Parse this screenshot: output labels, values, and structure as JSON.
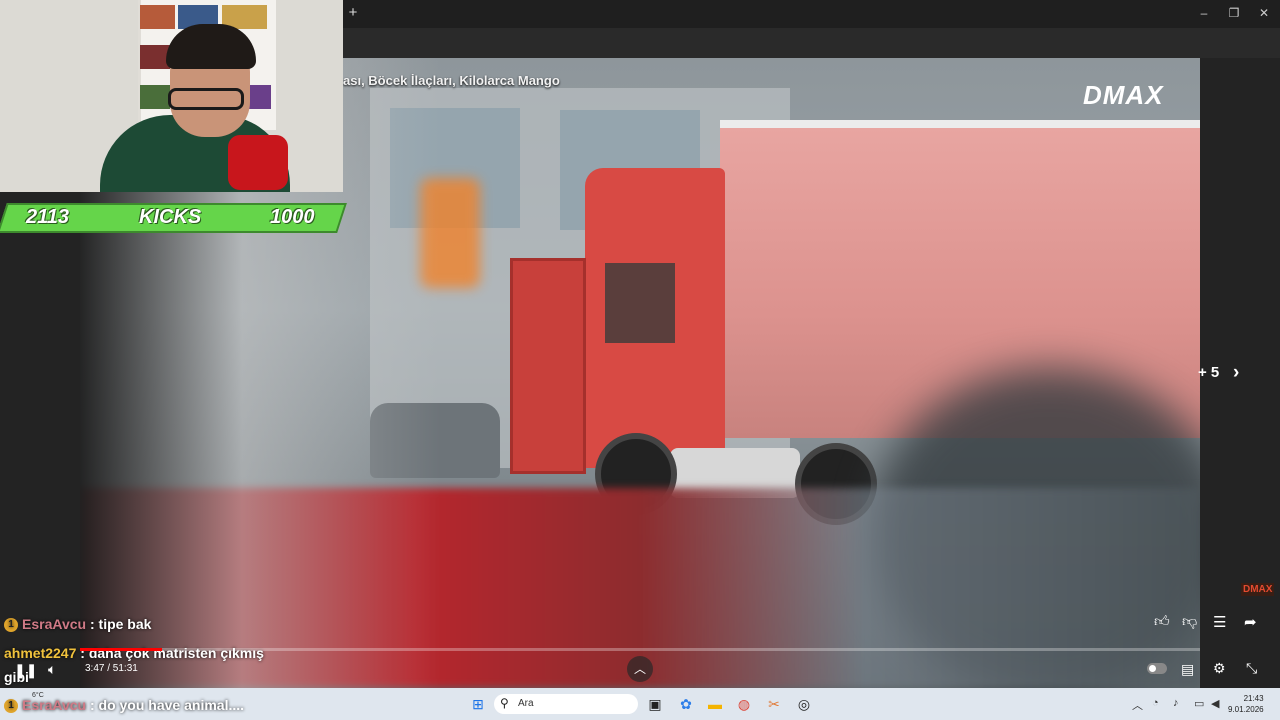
{
  "video": {
    "title": "ası, Böcek İlaçları, Kilolarca Mango",
    "logo": "DMAX",
    "logo_small": "DMAX",
    "more_label": "+ 5",
    "more_arrow": "›"
  },
  "overlay": {
    "kicks_left": "2113",
    "kicks_label": "KICKS",
    "kicks_right": "1000"
  },
  "chat": [
    {
      "user": "EsraAvcu",
      "sep": " : ",
      "message": "tipe bak",
      "badge": "1"
    },
    {
      "user": "ahmet2247",
      "sep": " : ",
      "message": "daha çok matristen çıkmış"
    },
    {
      "prefix": "gibi"
    },
    {
      "user": "EsraAvcu",
      "sep": " : ",
      "message": "do you have animal....",
      "badge": "1"
    }
  ],
  "player": {
    "time": "3:47 / 51:31",
    "progress_fraction": 0.073,
    "accent": "#ff0000"
  },
  "taskbar": {
    "search_placeholder": "Ara",
    "time": "21:43",
    "date": "9.01.2026",
    "weather": "6°C"
  },
  "browser": {
    "new_tab": "+",
    "minimize": "–",
    "restore": "❐",
    "close": "✕"
  }
}
